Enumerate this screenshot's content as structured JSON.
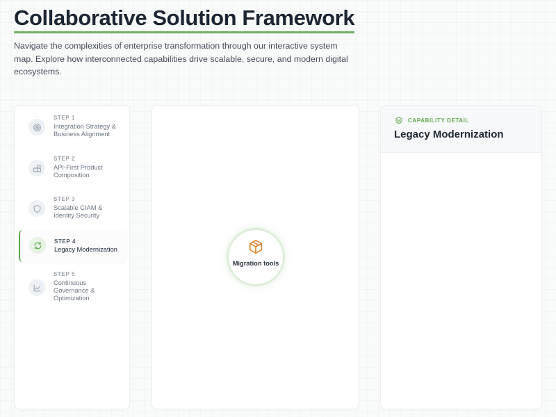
{
  "header": {
    "title": "Collaborative Solution Framework",
    "subtitle": "Navigate the complexities of enterprise transformation through our interactive system map. Explore how interconnected capabilities drive scalable, secure, and modern digital ecosystems."
  },
  "steps": [
    {
      "num": "STEP 1",
      "label": "Integration Strategy & Business Alignment",
      "icon": "target-icon",
      "active": false
    },
    {
      "num": "STEP 2",
      "label": "API-First Product Composition",
      "icon": "blocks-icon",
      "active": false
    },
    {
      "num": "STEP 3",
      "label": "Scalable CIAM & Identity Security",
      "icon": "shield-icon",
      "active": false
    },
    {
      "num": "STEP 4",
      "label": "Legacy Modernization",
      "icon": "refresh-icon",
      "active": true
    },
    {
      "num": "STEP 5",
      "label": "Continuous Governance & Optimization",
      "icon": "line-chart-icon",
      "active": false
    }
  ],
  "map": {
    "node_label": "Migration tools",
    "node_icon": "package-icon"
  },
  "detail": {
    "kicker": "CAPABILITY DETAIL",
    "title": "Legacy Modernization",
    "icon": "layers-icon"
  },
  "colors": {
    "accent": "#5ea94e",
    "node_icon": "#e0832c",
    "muted_icon": "#9aa3ad",
    "text": "#1c2532"
  }
}
